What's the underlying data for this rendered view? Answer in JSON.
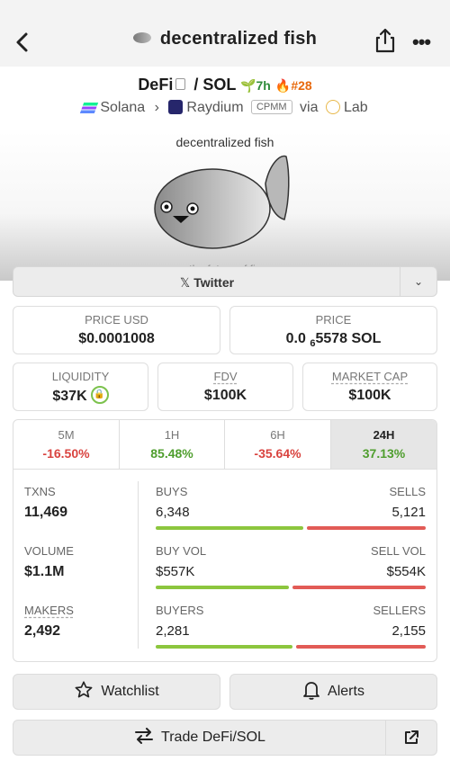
{
  "header": {
    "title": "decentralized fish"
  },
  "pair": {
    "base": "DeFi",
    "sep": "/",
    "quote": "SOL",
    "age": "7h",
    "rank": "#28"
  },
  "chain": {
    "network": "Solana",
    "dex": "Raydium",
    "pool_type": "CPMM",
    "via": "via",
    "launchpad": "Lab"
  },
  "banner": {
    "text": "decentralized fish",
    "subtext": "the future of fis"
  },
  "social": {
    "twitter_label": "Twitter"
  },
  "price": {
    "usd_label": "PRICE USD",
    "usd_value": "$0.0001008",
    "native_label": "PRICE",
    "native_prefix": "0.0",
    "native_zeros": "6",
    "native_digits": "5578 SOL"
  },
  "metrics": {
    "liquidity_label": "LIQUIDITY",
    "liquidity_value": "$37K",
    "fdv_label": "FDV",
    "fdv_value": "$100K",
    "mcap_label": "MARKET CAP",
    "mcap_value": "$100K"
  },
  "timeframes": [
    {
      "label": "5M",
      "change": "-16.50%"
    },
    {
      "label": "1H",
      "change": "85.48%"
    },
    {
      "label": "6H",
      "change": "-35.64%"
    },
    {
      "label": "24H",
      "change": "37.13%"
    }
  ],
  "stats": {
    "txns_label": "TXNS",
    "txns_value": "11,469",
    "buys_label": "BUYS",
    "buys_value": "6,348",
    "sells_label": "SELLS",
    "sells_value": "5,121",
    "buys_ratio": 0.553,
    "volume_label": "VOLUME",
    "volume_value": "$1.1M",
    "buy_vol_label": "BUY VOL",
    "buy_vol_value": "$557K",
    "sell_vol_label": "SELL VOL",
    "sell_vol_value": "$554K",
    "buy_vol_ratio": 0.501,
    "makers_label": "MAKERS",
    "makers_value": "2,492",
    "buyers_label": "BUYERS",
    "buyers_value": "2,281",
    "sellers_label": "SELLERS",
    "sellers_value": "2,155",
    "buyers_ratio": 0.514
  },
  "actions": {
    "watchlist": "Watchlist",
    "alerts": "Alerts",
    "trade": "Trade DeFi/SOL"
  },
  "colors": {
    "positive": "#4f9e2e",
    "negative": "#d9433f",
    "buy_bar": "#8cc63e",
    "sell_bar": "#e25b56"
  }
}
